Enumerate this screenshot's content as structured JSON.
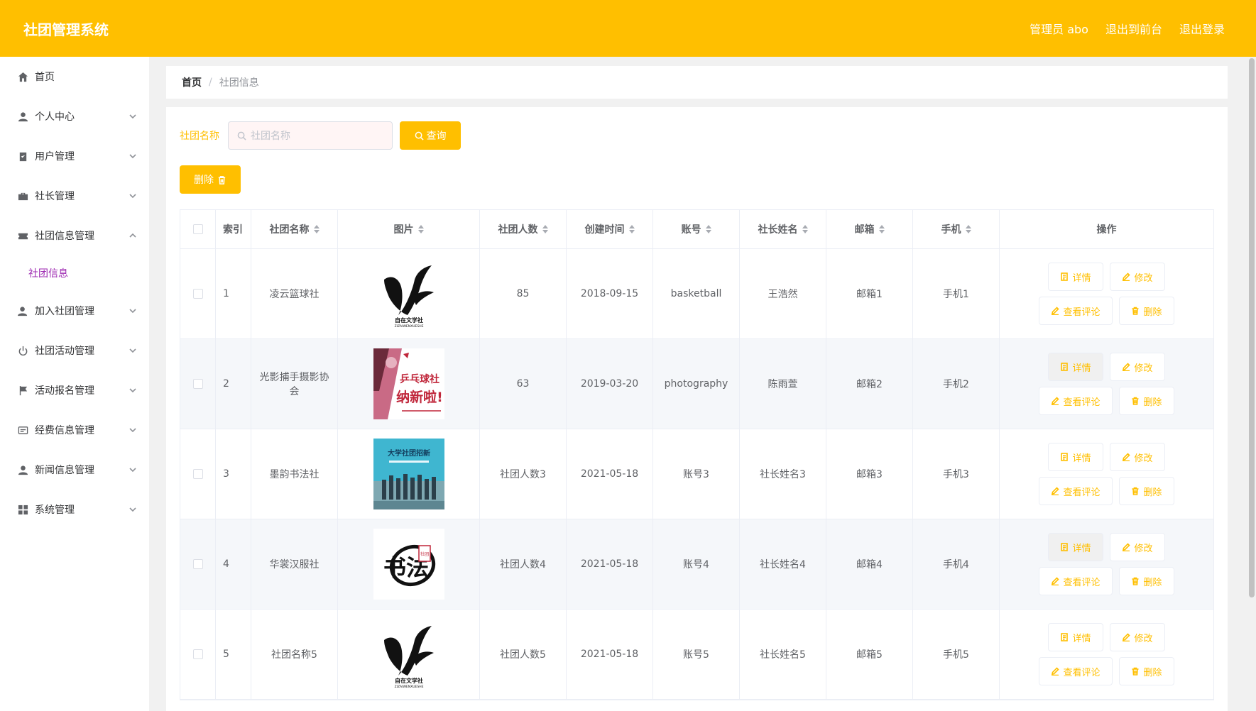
{
  "app": {
    "title": "社团管理系统"
  },
  "header": {
    "user": "管理员 abo",
    "to_front": "退出到前台",
    "logout": "退出登录"
  },
  "sidebar": {
    "items": [
      {
        "label": "首页",
        "icon": "home-icon",
        "chevron": false
      },
      {
        "label": "个人中心",
        "icon": "user-icon",
        "chevron": true
      },
      {
        "label": "用户管理",
        "icon": "clipboard-icon",
        "chevron": true
      },
      {
        "label": "社长管理",
        "icon": "briefcase-icon",
        "chevron": true
      },
      {
        "label": "社团信息管理",
        "icon": "ticket-icon",
        "chevron": true,
        "expanded": true
      },
      {
        "label": "加入社团管理",
        "icon": "user-add-icon",
        "chevron": true
      },
      {
        "label": "社团活动管理",
        "icon": "power-icon",
        "chevron": true
      },
      {
        "label": "活动报名管理",
        "icon": "flag-icon",
        "chevron": true
      },
      {
        "label": "经费信息管理",
        "icon": "card-icon",
        "chevron": true
      },
      {
        "label": "新闻信息管理",
        "icon": "person-icon",
        "chevron": true
      },
      {
        "label": "系统管理",
        "icon": "grid-icon",
        "chevron": true
      }
    ],
    "active_sub": "社团信息"
  },
  "breadcrumb": {
    "home": "首页",
    "separator": "/",
    "current": "社团信息"
  },
  "search": {
    "label": "社团名称",
    "placeholder": "社团名称",
    "button": "查询"
  },
  "toolbar": {
    "delete": "删除"
  },
  "table": {
    "headers": [
      "索引",
      "社团名称",
      "图片",
      "社团人数",
      "创建时间",
      "账号",
      "社长姓名",
      "邮箱",
      "手机",
      "操作"
    ],
    "rows": [
      {
        "idx": "1",
        "name": "凌云篮球社",
        "count": "85",
        "date": "2018-09-15",
        "account": "basketball",
        "leader": "王浩然",
        "email": "邮箱1",
        "phone": "手机1",
        "image": "logo-literary"
      },
      {
        "idx": "2",
        "name": "光影捕手摄影协会",
        "count": "63",
        "date": "2019-03-20",
        "account": "photography",
        "leader": "陈雨萱",
        "email": "邮箱2",
        "phone": "手机2",
        "image": "poster-recruit"
      },
      {
        "idx": "3",
        "name": "墨韵书法社",
        "count": "社团人数3",
        "date": "2021-05-18",
        "account": "账号3",
        "leader": "社长姓名3",
        "email": "邮箱3",
        "phone": "手机3",
        "image": "photo-group"
      },
      {
        "idx": "4",
        "name": "华裳汉服社",
        "count": "社团人数4",
        "date": "2021-05-18",
        "account": "账号4",
        "leader": "社长姓名4",
        "email": "邮箱4",
        "phone": "手机4",
        "image": "logo-calligraphy"
      },
      {
        "idx": "5",
        "name": "社团名称5",
        "count": "社团人数5",
        "date": "2021-05-18",
        "account": "账号5",
        "leader": "社长姓名5",
        "email": "邮箱5",
        "phone": "手机5",
        "image": "logo-literary"
      }
    ],
    "ops": {
      "detail": "详情",
      "edit": "修改",
      "review": "查看评论",
      "delete": "删除"
    },
    "logo_text": {
      "cn": "自在文学社",
      "en": "ZIZAIWENXUESHE"
    },
    "poster_text": {
      "line1": "乒乓球社",
      "line2": "纳新啦!"
    },
    "photo_text": {
      "line1": "大学社团招新"
    },
    "calligraphy_text": {
      "main": "书法",
      "seal": "社团"
    }
  },
  "colors": {
    "accent": "#ffbf00",
    "active_sub": "#9c27b0"
  }
}
